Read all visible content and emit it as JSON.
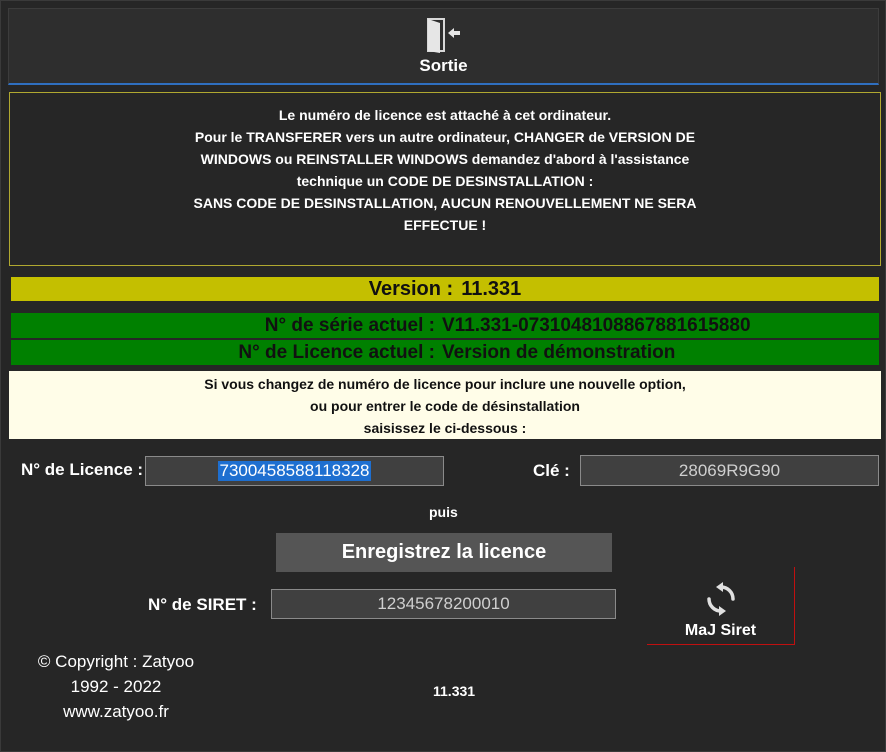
{
  "exit": {
    "label": "Sortie",
    "icon": "exit-door-icon"
  },
  "warning": {
    "color": "#b0a830",
    "lines": [
      "Le numéro de licence est attaché à cet ordinateur.",
      "Pour le TRANSFERER vers un autre ordinateur, CHANGER de VERSION DE",
      "WINDOWS ou REINSTALLER WINDOWS demandez d'abord à l'assistance",
      "technique un CODE DE DESINSTALLATION :",
      "SANS CODE DE DESINSTALLATION, AUCUN RENOUVELLEMENT NE SERA",
      "EFFECTUE !"
    ]
  },
  "version": {
    "label": "Version :",
    "value": "11.331",
    "color": "#c4bf00"
  },
  "serial": {
    "label": "N° de série actuel :",
    "value": "V11.331-07310481088678816158​80"
  },
  "licence_current": {
    "label": "N° de Licence actuel :",
    "value": "Version de démonstration"
  },
  "instructions": {
    "lines": [
      "Si vous changez de  numéro de licence pour inclure une nouvelle option,",
      "ou pour entrer le code de désinstallation",
      "saisissez le ci-dessous :"
    ]
  },
  "form": {
    "licence_label": "N° de Licence :",
    "licence_value": "7300458588118328",
    "cle_label": "Clé :",
    "cle_value": "28069R9G90",
    "puis": "puis",
    "register_label": "Enregistrez la licence",
    "siret_label": "N° de SIRET :",
    "siret_value": "12345678200010"
  },
  "maj": {
    "label": "MaJ Siret",
    "icon": "refresh-icon"
  },
  "copyright": {
    "lines": [
      "© Copyright : Zatyoo",
      "1992 - 2022",
      "www.zatyoo.fr"
    ]
  },
  "footer_version": "11.331"
}
